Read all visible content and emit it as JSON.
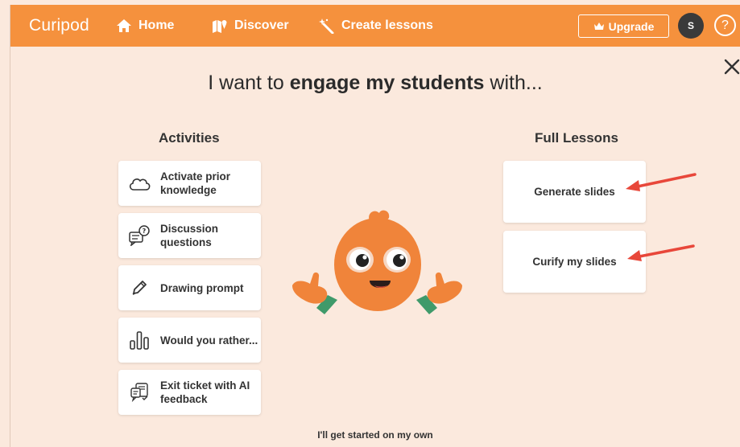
{
  "nav": {
    "logo": "Curipod",
    "home": "Home",
    "discover": "Discover",
    "create": "Create lessons",
    "upgrade": "Upgrade",
    "avatar_initial": "S",
    "help": "?"
  },
  "headline": {
    "prefix": "I want to ",
    "emphasis": "engage my students",
    "suffix": " with..."
  },
  "activities": {
    "title": "Activities",
    "items": [
      {
        "label": "Activate prior knowledge",
        "icon": "cloud-icon"
      },
      {
        "label": "Discussion questions",
        "icon": "chat-question-icon"
      },
      {
        "label": "Drawing prompt",
        "icon": "pencil-icon"
      },
      {
        "label": "Would you rather...",
        "icon": "bar-chart-icon"
      },
      {
        "label": "Exit ticket with AI feedback",
        "icon": "exit-ticket-icon"
      }
    ]
  },
  "lessons": {
    "title": "Full Lessons",
    "items": [
      {
        "label": "Generate slides"
      },
      {
        "label": "Curify my slides"
      }
    ]
  },
  "footer": {
    "start_own": "I'll get started on my own"
  },
  "colors": {
    "brand": "#f5913d",
    "background": "#fbe9dd",
    "arrow": "#e8473a",
    "mascot": "#f0843a"
  }
}
